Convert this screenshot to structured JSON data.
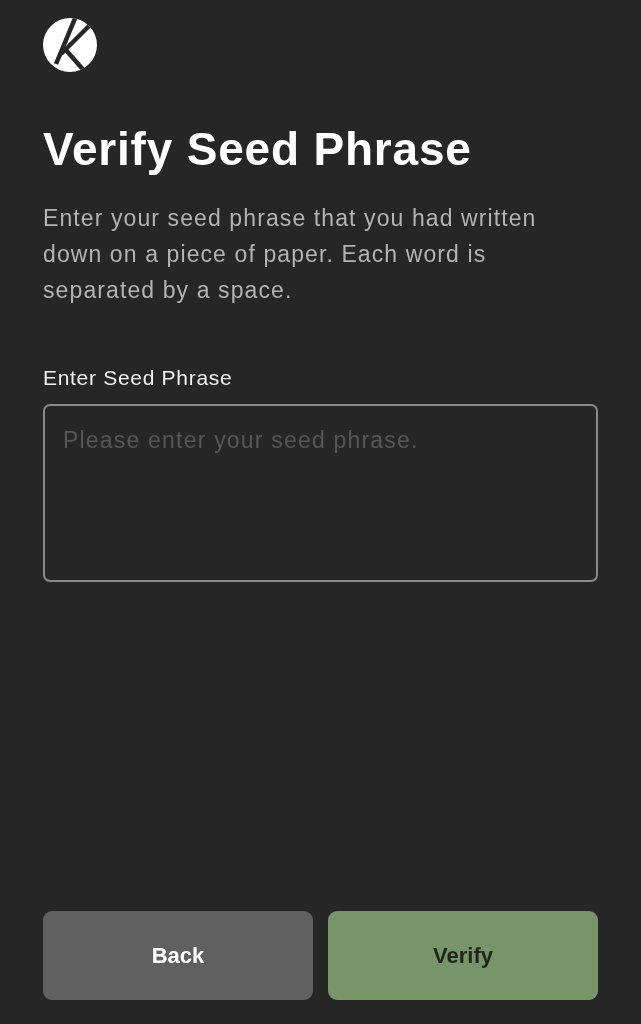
{
  "title": "Verify Seed Phrase",
  "description": "Enter your seed phrase that you had written down on a piece of paper. Each word is separated by a space.",
  "seed_field": {
    "label": "Enter Seed Phrase",
    "placeholder": "Please enter your seed phrase."
  },
  "buttons": [
    {
      "label": "Back",
      "kind": "secondary"
    },
    {
      "label": "Verify",
      "kind": "primary"
    }
  ]
}
